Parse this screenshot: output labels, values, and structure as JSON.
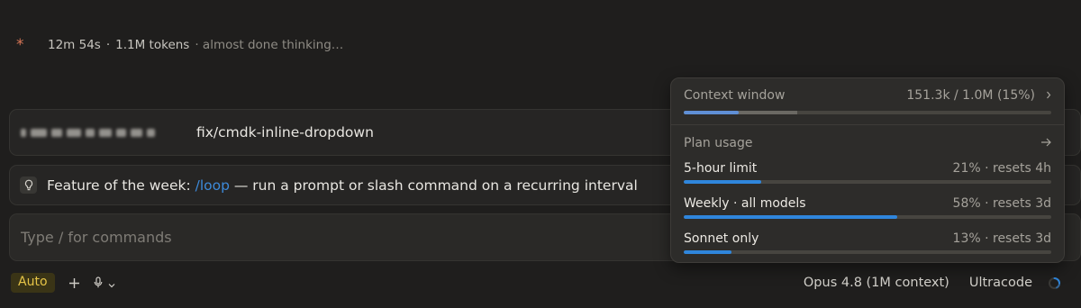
{
  "thinking": {
    "asterisk": "*",
    "elapsed": "12m 54s",
    "separator": "·",
    "tokens": "1.1M tokens",
    "status": "· almost done thinking…"
  },
  "branch": {
    "name": "fix/cmdk-inline-dropdown"
  },
  "feature": {
    "prefix": "Feature of the week: ",
    "command": "/loop",
    "description": " — run a prompt or slash command on a recurring interval",
    "icon": "lightbulb-icon"
  },
  "composer": {
    "placeholder": "Type / for commands"
  },
  "toolbar": {
    "mode_label": "Auto",
    "add_icon": "plus-icon",
    "mic_icon": "microphone-icon",
    "chevron_icon": "chevron-down-icon",
    "model_label": "Opus 4.8 (1M context)",
    "mode_name": "Ultracode",
    "spinner_icon": "spinner-icon"
  },
  "context_popover": {
    "context": {
      "label": "Context window",
      "value": "151.3k / 1.0M (15%)",
      "used_fraction": 0.15,
      "secondary_fraction": 0.31
    },
    "plan": {
      "label": "Plan usage",
      "limits": [
        {
          "label": "5-hour limit",
          "value": "21% · resets 4h",
          "used_fraction": 0.21
        },
        {
          "label": "Weekly · all models",
          "value": "58% · resets 3d",
          "used_fraction": 0.58
        },
        {
          "label": "Sonnet only",
          "value": "13% · resets 3d",
          "used_fraction": 0.13
        }
      ]
    },
    "colors": {
      "bar_fill": "#2f86dc",
      "context_fill": "#5f8fd6"
    }
  },
  "colors": {
    "background": "#1f1e1d",
    "accent_orange": "#d97757",
    "link_blue": "#3d8ad9",
    "auto_badge_text": "#e6c447"
  }
}
